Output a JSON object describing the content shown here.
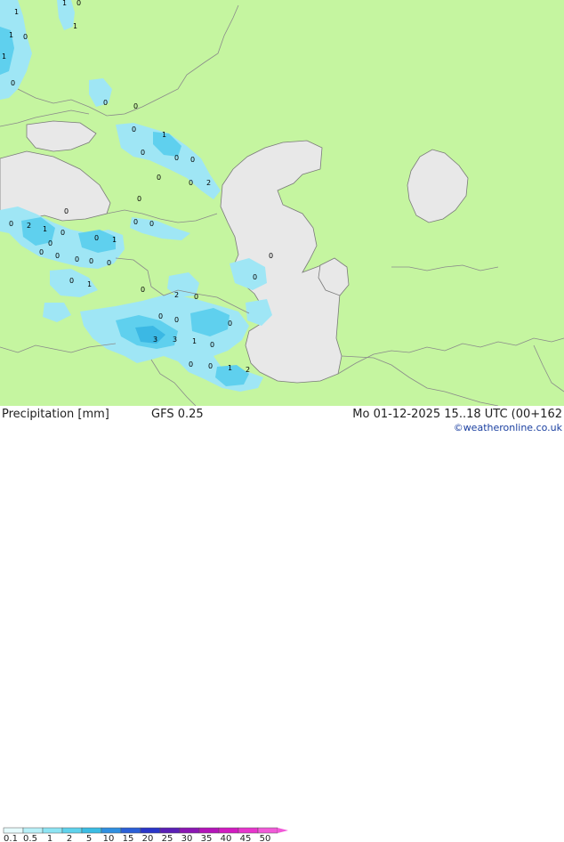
{
  "map": {
    "colors": {
      "land": "#c5f5a0",
      "sea": "#e8e8e8",
      "border": "#8a8a8a",
      "coast": "#7a7a7a",
      "precip_light": "#9fe6f5",
      "precip_mid": "#5fd0ee",
      "precip_heavy": "#3bb8e4"
    },
    "point_labels": [
      "1",
      "1",
      "0",
      "1",
      "1",
      "0",
      "1",
      "0",
      "0",
      "0",
      "1",
      "0",
      "0",
      "0",
      "0",
      "0",
      "0",
      "2",
      "0",
      "0",
      "0",
      "2",
      "1",
      "0",
      "0",
      "0",
      "0",
      "0",
      "0",
      "0",
      "0",
      "0",
      "1",
      "0",
      "0",
      "0",
      "0",
      "1",
      "0",
      "2",
      "0",
      "0",
      "3",
      "3",
      "1",
      "0",
      "0",
      "0",
      "0",
      "0",
      "1",
      "2"
    ]
  },
  "footer": {
    "title": "Precipitation [mm]",
    "model": "GFS 0.25",
    "timestamp": "Mo 01-12-2025 15..18 UTC (00+162",
    "credit": "©weatheronline.co.uk",
    "legend": {
      "ticks": [
        "0.1",
        "0.5",
        "1",
        "2",
        "5",
        "10",
        "15",
        "20",
        "25",
        "30",
        "35",
        "40",
        "45",
        "50"
      ],
      "colors": [
        "#e6fbfd",
        "#b8f0f8",
        "#8de4f3",
        "#5fd2ec",
        "#3bbce3",
        "#2f8fe0",
        "#2b5fd6",
        "#2a35c8",
        "#5a1fb5",
        "#8a16b2",
        "#b314b8",
        "#d11bc0",
        "#e735cc",
        "#f15ad8"
      ]
    }
  }
}
